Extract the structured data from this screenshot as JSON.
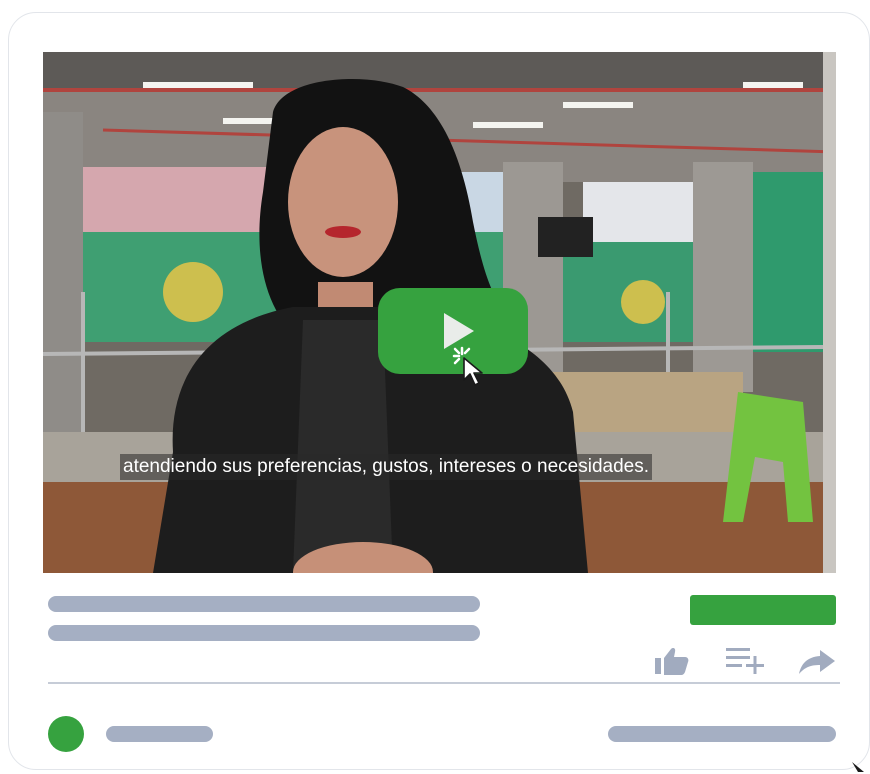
{
  "video": {
    "subtitle": "atendiendo sus preferencias, gustos, intereses o necesidades."
  },
  "icons": {
    "play": "play-icon",
    "cursor": "pointer-cursor-icon",
    "like": "thumbs-up-icon",
    "add_to_playlist": "playlist-add-icon",
    "share": "share-icon"
  },
  "colors": {
    "accent_green": "#36a23f",
    "placeholder_gray": "#a5afc3",
    "icon_gray": "#a1abbf"
  }
}
